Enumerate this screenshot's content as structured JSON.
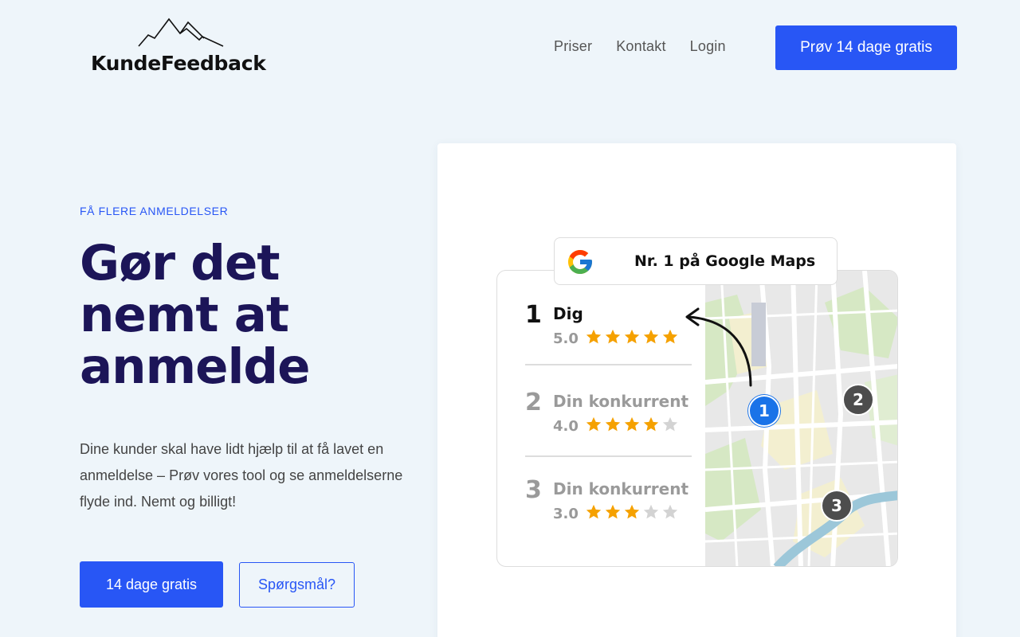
{
  "header": {
    "logo_text": "KundeFeedback",
    "nav": [
      "Priser",
      "Kontakt",
      "Login"
    ],
    "cta": "Prøv 14 dage gratis"
  },
  "hero": {
    "eyebrow": "FÅ FLERE ANMELDELSER",
    "headline_lines": [
      "Gør det",
      "nemt at",
      "anmelde"
    ],
    "lead": "Dine kunder skal have lidt hjælp til at få lavet en anmeldelse – Prøv vores tool og se anmeldelserne flyde ind. Nemt og billigt!",
    "primary_button": "14 dage gratis",
    "secondary_button": "Spørgsmål?"
  },
  "illustration": {
    "badge_text": "Nr. 1 på Google Maps",
    "ranking": [
      {
        "rank": "1",
        "name": "Dig",
        "score": "5.0",
        "stars": 5
      },
      {
        "rank": "2",
        "name": "Din konkurrent",
        "score": "4.0",
        "stars": 4
      },
      {
        "rank": "3",
        "name": "Din konkurrent",
        "score": "3.0",
        "stars": 3
      }
    ],
    "pins": [
      "1",
      "2",
      "3"
    ]
  },
  "colors": {
    "accent": "#2856f5",
    "headline": "#1c1558",
    "star_on": "#f5a100",
    "star_off": "#d3d3d3",
    "pin_blue": "#1a73e8",
    "pin_dark": "#4d4d4d"
  }
}
